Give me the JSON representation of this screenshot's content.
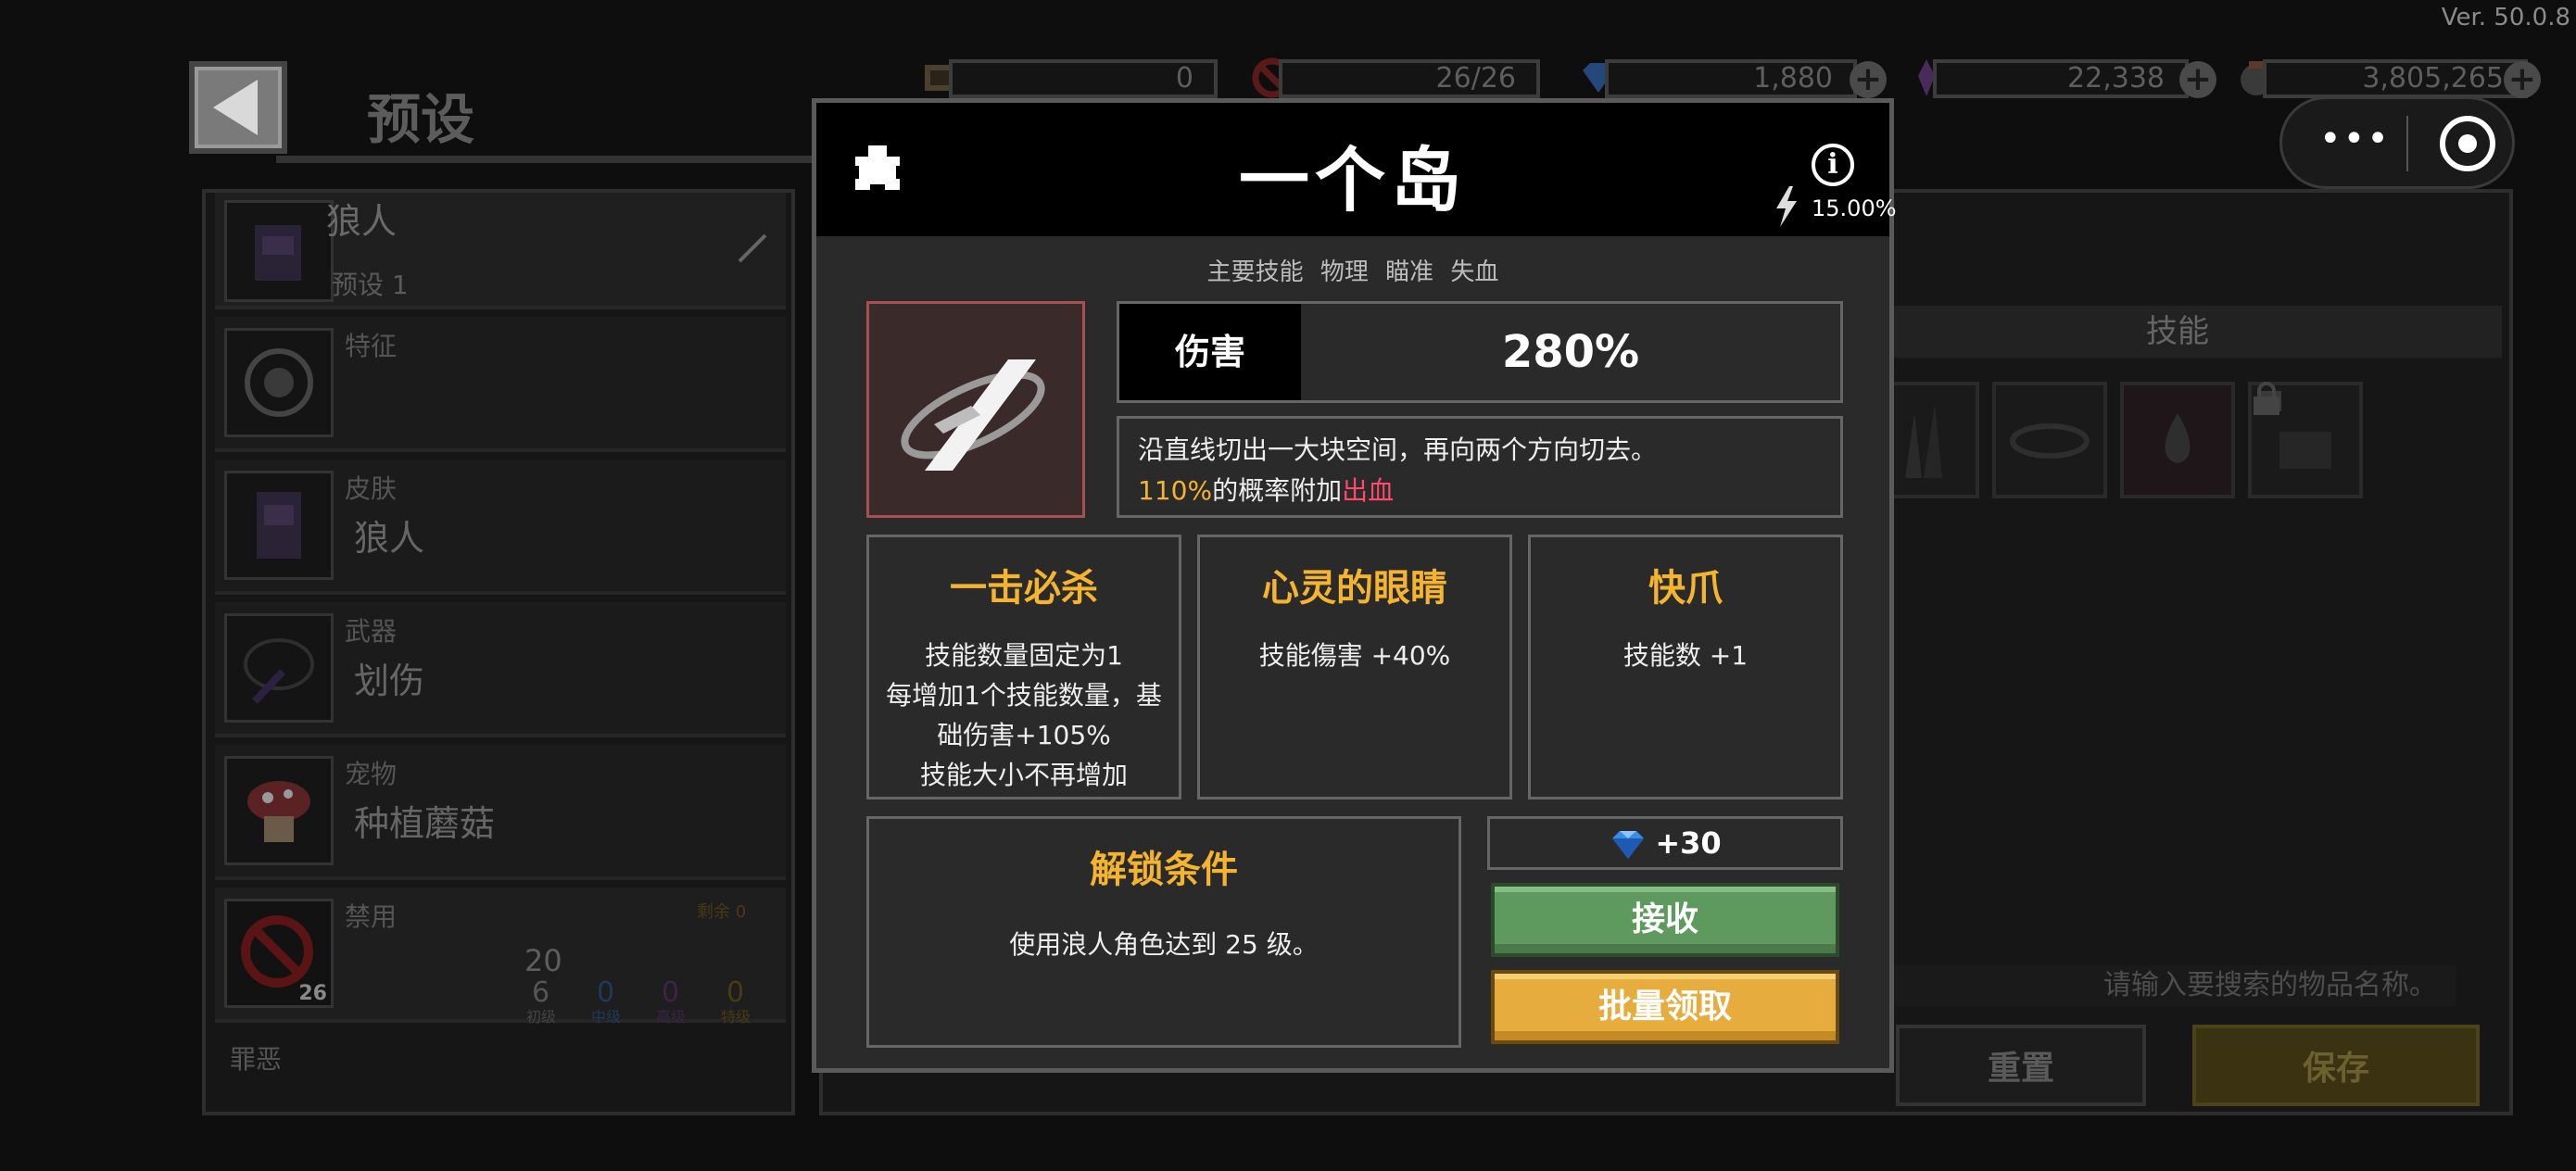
{
  "version": "Ver. 50.0.8",
  "header": {
    "title": "预设",
    "resources": [
      {
        "icon": "ticket-icon",
        "value": "0"
      },
      {
        "icon": "ban-icon",
        "value": "26/26"
      },
      {
        "icon": "diamond-icon",
        "value": "1,880"
      },
      {
        "icon": "purple-crystal-icon",
        "value": "22,338"
      },
      {
        "icon": "coin-bag-icon",
        "value": "3,805,265"
      }
    ],
    "plus": "+"
  },
  "capsule": {
    "more": "•••"
  },
  "left": {
    "character_name": "狼人",
    "preset_label": "预设 1",
    "rows": [
      {
        "category": "特征",
        "name": ""
      },
      {
        "category": "皮肤",
        "name": "狼人"
      },
      {
        "category": "武器",
        "name": "划伤"
      },
      {
        "category": "宠物",
        "name": "种植蘑菇"
      },
      {
        "category": "禁用",
        "name": ""
      }
    ],
    "ban_count": "20",
    "ban_badge": "26",
    "remaining": "剩余 0",
    "tier_values": [
      "6",
      "0",
      "0",
      "0"
    ],
    "tier_labels": [
      "初级",
      "中级",
      "高级",
      "特级"
    ],
    "sin_label": "罪恶"
  },
  "right": {
    "skills_header": "技能",
    "search_placeholder": "请输入要搜索的物品名称。",
    "reset": "重置",
    "save": "保存"
  },
  "modal": {
    "title": "一个岛",
    "chance": "15.00%",
    "tags": "主要技能  物理  瞄准  失血",
    "damage_label": "伤害",
    "damage_value": "280%",
    "desc_line1": "沿直线切出一大块空间，再向两个方向切去。",
    "desc_pct": "110%",
    "desc_mid": "的概率附加",
    "desc_bleed": "出血",
    "perks": [
      {
        "title": "一击必杀",
        "desc": [
          "技能数量固定为1",
          "每增加1个技能数量，基",
          "础伤害+105%",
          "技能大小不再增加"
        ]
      },
      {
        "title": "心灵的眼睛",
        "desc": [
          "技能傷害 +40%"
        ]
      },
      {
        "title": "快爪",
        "desc": [
          "技能数 +1"
        ]
      }
    ],
    "unlock_title": "解锁条件",
    "unlock_desc": "使用浪人角色达到 25 级。",
    "reward": "+30",
    "receive": "接收",
    "bulk_claim": "批量领取"
  }
}
